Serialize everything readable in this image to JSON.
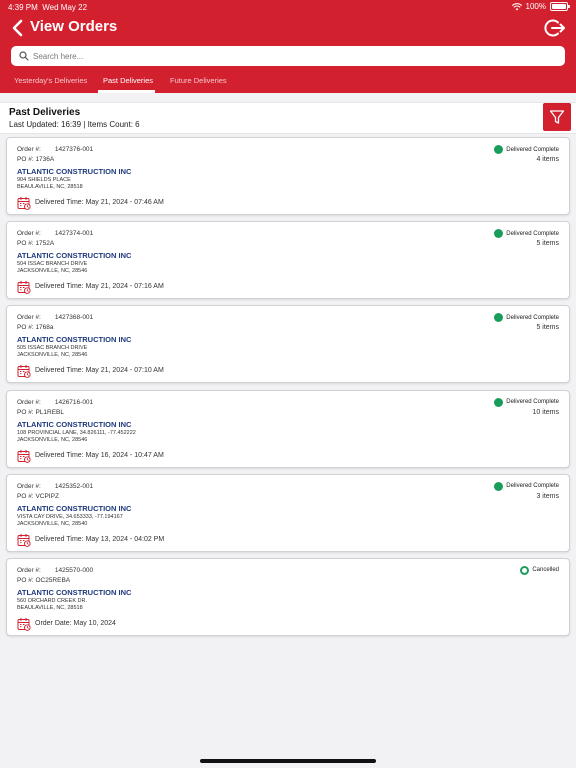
{
  "status_bar": {
    "time": "4:39 PM",
    "date": "Wed May 22",
    "battery": "100%"
  },
  "header": {
    "title": "View Orders"
  },
  "search": {
    "placeholder": "Search here..."
  },
  "tabs": [
    {
      "label": "Yesterday's Deliveries",
      "active": false
    },
    {
      "label": "Past Deliveries",
      "active": true
    },
    {
      "label": "Future Deliveries",
      "active": false
    }
  ],
  "summary": {
    "title": "Past Deliveries",
    "subtitle": "Last Updated: 16:39 | Items Count: 6"
  },
  "labels": {
    "order": "Order #:",
    "po": "PO #:"
  },
  "colors": {
    "brand": "#d3202f",
    "status_green": "#1a9c5a",
    "customer_blue": "#1e3a7d"
  },
  "orders": [
    {
      "order_no": "1427376-001",
      "po": "1736A",
      "customer": "ATLANTIC CONSTRUCTION INC",
      "address1": "904 SHIELDS PLACE",
      "address2": "BEAULAVILLE, NC, 28518",
      "time_text": "Delivered Time: May 21, 2024 - 07:46 AM",
      "status": "Delivered Complete",
      "items": "4 items"
    },
    {
      "order_no": "1427374-001",
      "po": "1752A",
      "customer": "ATLANTIC CONSTRUCTION INC",
      "address1": "504 ISSAC BRANCH DRIVE",
      "address2": "JACKSONVILLE, NC, 28546",
      "time_text": "Delivered Time: May 21, 2024 - 07:16 AM",
      "status": "Delivered Complete",
      "items": "5 items"
    },
    {
      "order_no": "1427368-001",
      "po": "1768a",
      "customer": "ATLANTIC CONSTRUCTION INC",
      "address1": "505 ISSAC BRANCH DRIVE",
      "address2": "JACKSONVILLE, NC, 28546",
      "time_text": "Delivered Time: May 21, 2024 - 07:10 AM",
      "status": "Delivered Complete",
      "items": "5 items"
    },
    {
      "order_no": "1426716-001",
      "po": "PL1REBL",
      "customer": "ATLANTIC CONSTRUCTION INC",
      "address1": "108 PROVINCIAL LANE, 34.826111, -77.452222",
      "address2": "JACKSONVILLE, NC, 28546",
      "time_text": "Delivered Time: May 16, 2024 - 10:47 AM",
      "status": "Delivered Complete",
      "items": "10 items"
    },
    {
      "order_no": "1425352-001",
      "po": "VCPIPZ",
      "customer": "ATLANTIC CONSTRUCTION INC",
      "address1": "VISTA CAY DRIVE, 34.653333, -77.194167",
      "address2": "JACKSONVILLE, NC, 28540",
      "time_text": "Delivered Time: May 13, 2024 - 04:02 PM",
      "status": "Delivered Complete",
      "items": "3 items"
    },
    {
      "order_no": "1425570-000",
      "po": "OC25REBA",
      "customer": "ATLANTIC CONSTRUCTION INC",
      "address1": "560 ORCHARD CREEK DR.",
      "address2": "BEAULAVILLE, NC, 28518",
      "time_text": "Order Date: May 10, 2024",
      "status": "Cancelled",
      "items": ""
    }
  ]
}
